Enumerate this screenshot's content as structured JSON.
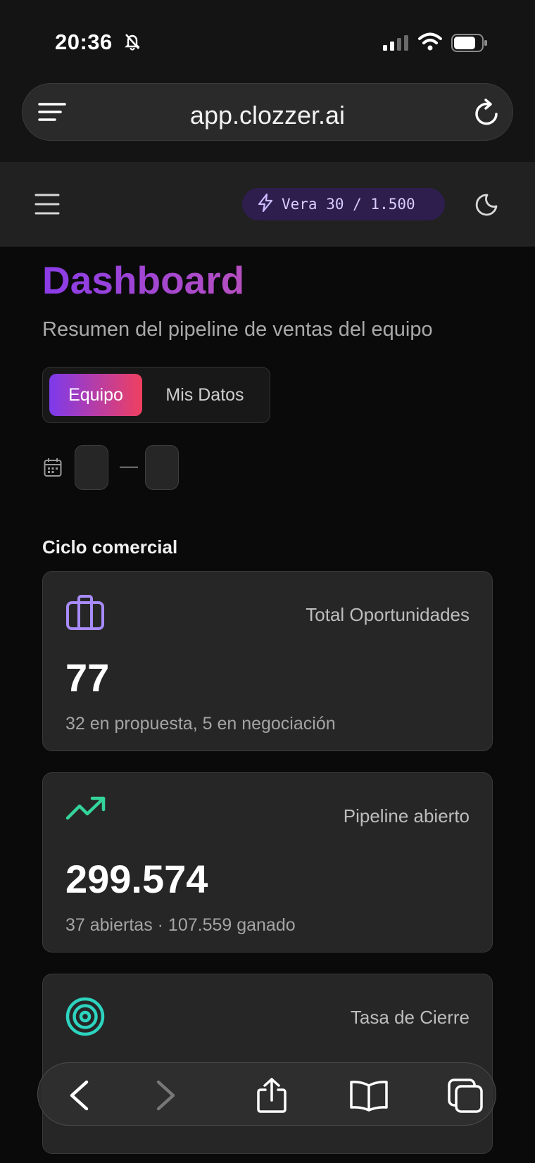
{
  "status_bar": {
    "time": "20:36"
  },
  "browser": {
    "url": "app.clozzer.ai"
  },
  "header": {
    "credits": "Vera 30 / 1.500"
  },
  "page": {
    "title": "Dashboard",
    "subtitle": "Resumen del pipeline de ventas del equipo"
  },
  "view_toggle": {
    "options": [
      "Equipo",
      "Mis Datos"
    ],
    "selected": "Equipo"
  },
  "date_range": {
    "separator": "—"
  },
  "section": {
    "title": "Ciclo comercial"
  },
  "cards": [
    {
      "label": "Total Oportunidades",
      "value": "77",
      "sub": "32 en propuesta, 5 en negociación",
      "icon": "briefcase-icon",
      "icon_color": "#a78bfa"
    },
    {
      "label": "Pipeline abierto",
      "value": "299.574",
      "sub": "37 abiertas · 107.559 ganado",
      "icon": "trending-up-icon",
      "icon_color": "#34d399"
    },
    {
      "label": "Tasa de Cierre",
      "value": "",
      "sub": "",
      "icon": "target-icon",
      "icon_color": "#2dd4bf"
    }
  ],
  "toolbar": {
    "icons": [
      "back-icon",
      "forward-icon",
      "share-icon",
      "bookmarks-icon",
      "tabs-icon"
    ]
  },
  "colors": {
    "accent_purple": "#7c3aed",
    "accent_pink": "#ef4060",
    "background": "#0a0a0a",
    "card": "#262626"
  }
}
